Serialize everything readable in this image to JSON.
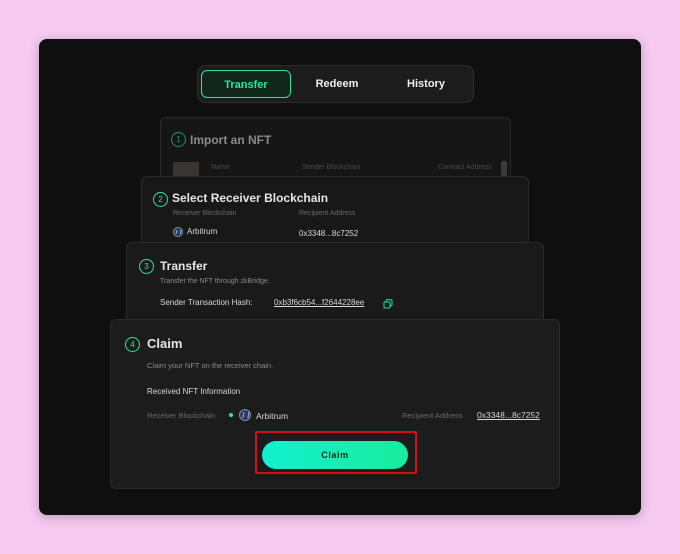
{
  "tabs": [
    {
      "label": "Transfer",
      "active": true
    },
    {
      "label": "Redeem",
      "active": false
    },
    {
      "label": "History",
      "active": false
    }
  ],
  "step1": {
    "number": "1",
    "title": "Import an NFT",
    "columns": [
      "Name",
      "Sender Blockchain",
      "Contract Address"
    ]
  },
  "step2": {
    "number": "2",
    "title": "Select Receiver Blockchain",
    "receiver_label": "Receiver Blockchain",
    "receiver_value": "Arbitrum",
    "recipient_label": "Recipient Address",
    "recipient_value": "0x3348...8c7252"
  },
  "step3": {
    "number": "3",
    "title": "Transfer",
    "description": "Transfer the NFT through zkBridge.",
    "hash_label": "Sender Transaction Hash:",
    "hash_value": "0xb3f6cb54...f2644228ee"
  },
  "step4": {
    "number": "4",
    "title": "Claim",
    "description": "Claim your NFT on the receiver chain.",
    "section_label": "Received NFT Information",
    "receiver_label": "Receiver Blockchain",
    "receiver_value": "Arbitrum",
    "recipient_label": "Recipient Address",
    "recipient_value": "0x3348...8c7252",
    "claim_label": "Claim"
  },
  "colors": {
    "accent": "#2ee59d",
    "highlight": "#d20f14",
    "background": "#f6c9f0"
  },
  "icons": {
    "chain": "arbitrum-logo-icon",
    "copy": "copy-icon"
  }
}
